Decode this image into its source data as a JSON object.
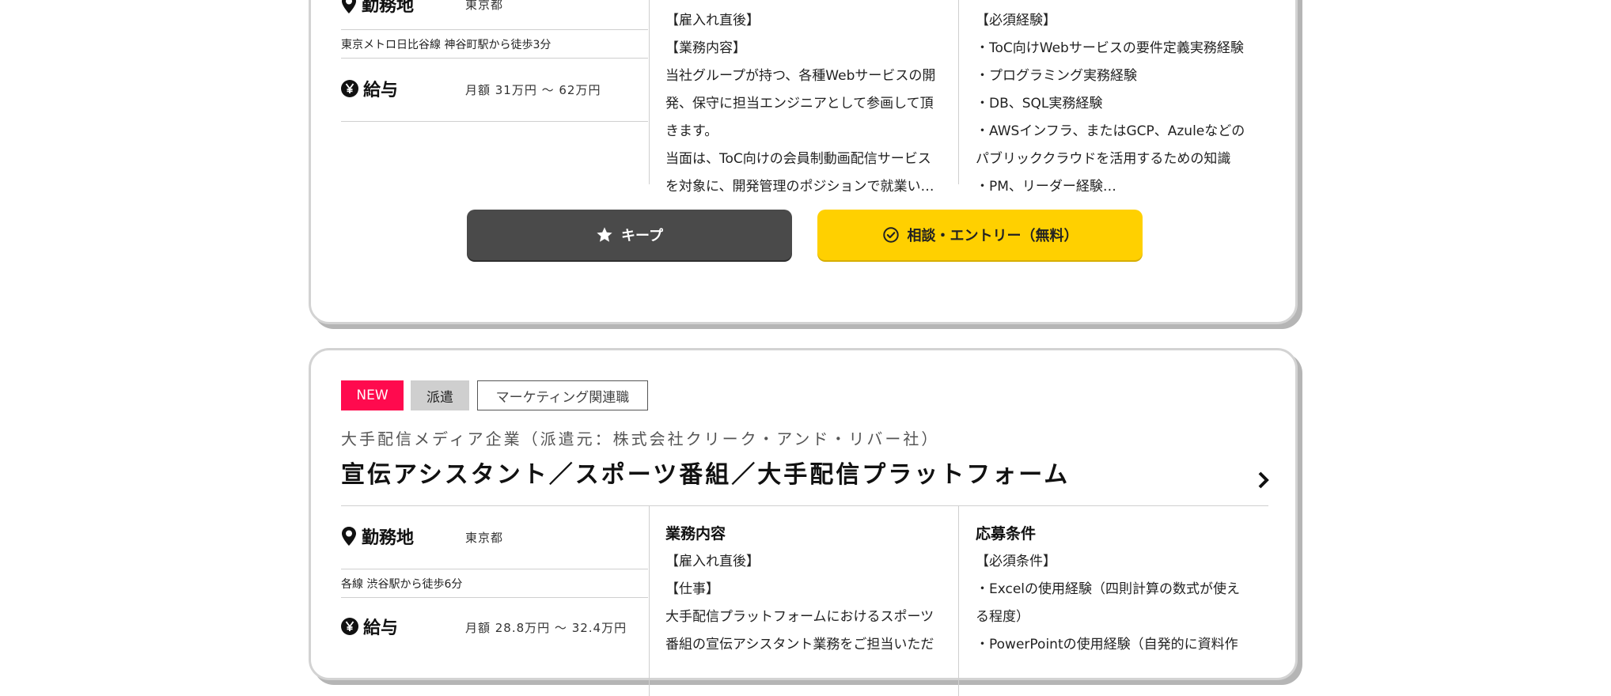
{
  "card1": {
    "location": {
      "label": "勤務地",
      "value": "東京都"
    },
    "access": "東京メトロ日比谷線 神谷町駅から徒歩3分",
    "salary": {
      "label": "給与",
      "value": "月額 31万円 ～ 62万円"
    },
    "job_lines": [
      "【雇入れ直後】",
      "【業務内容】",
      "当社グループが持つ、各種Webサービスの開",
      "発、保守に担当エンジニアとして参画して頂",
      "きます。",
      "当面は、ToC向けの会員制動画配信サービス",
      "を対象に、開発管理のポジションで就業い…"
    ],
    "req_lines": [
      "【必須経験】",
      "・ToC向けWebサービスの要件定義実務経験",
      "・プログラミング実務経験",
      "・DB、SQL実務経験",
      "・AWSインフラ、またはGCP、Azuleなどの",
      "パブリッククラウドを活用するための知識",
      "・PM、リーダー経験…"
    ],
    "keep_label": "キープ",
    "entry_label": "相談・エントリー（無料）"
  },
  "card2": {
    "tags": {
      "new": "NEW",
      "type": "派遣",
      "category": "マーケティング関連職"
    },
    "company": "大手配信メディア企業（派遣元：株式会社クリーク・アンド・リバー社）",
    "title": "宣伝アシスタント／スポーツ番組／大手配信プラットフォーム",
    "location": {
      "label": "勤務地",
      "value": "東京都"
    },
    "access": "各線 渋谷駅から徒歩6分",
    "salary": {
      "label": "給与",
      "value": "月額 28.8万円 ～ 32.4万円"
    },
    "job_heading": "業務内容",
    "job_lines": [
      "【雇入れ直後】",
      "【仕事】",
      "大手配信プラットフォームにおけるスポーツ",
      "番組の宣伝アシスタント業務をご担当いただ"
    ],
    "req_heading": "応募条件",
    "req_lines": [
      "【必須条件】",
      "・Excelの使用経験（四則計算の数式が使え",
      "る程度）",
      "・PowerPointの使用経験（自発的に資料作"
    ]
  },
  "icons": {
    "location": "map-pin-icon",
    "salary": "yen-icon",
    "keep": "star-icon",
    "entry": "check-circle-icon",
    "detail": "chevron-right-icon"
  }
}
